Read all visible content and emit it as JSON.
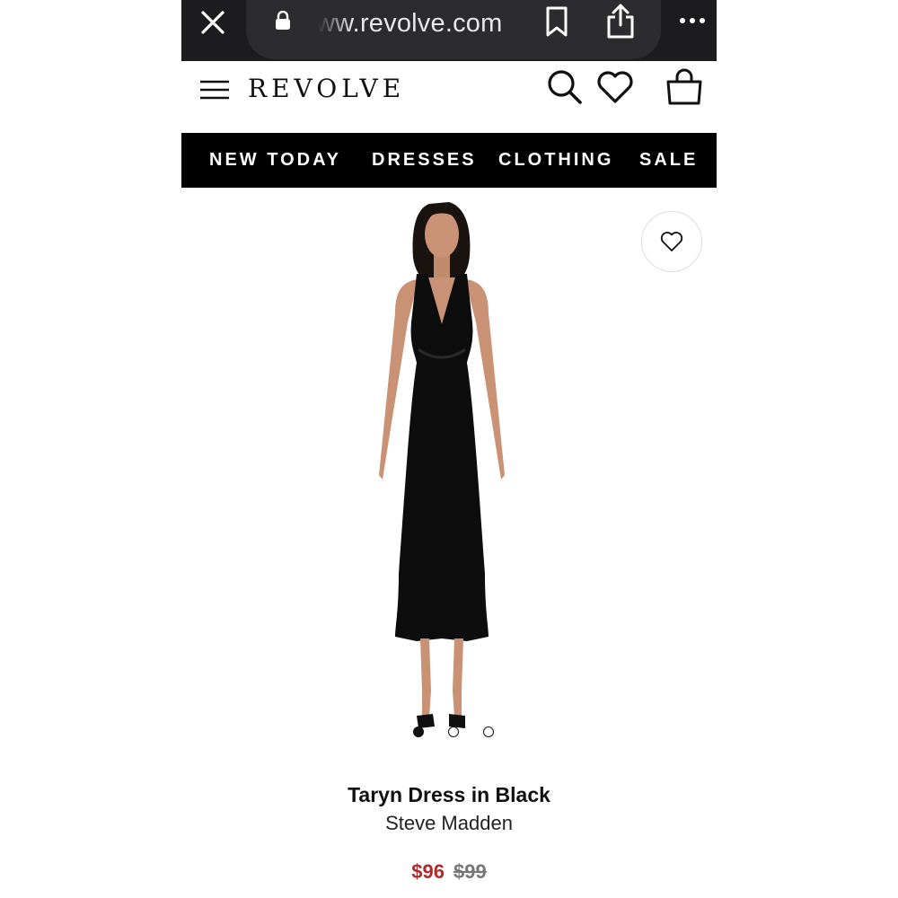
{
  "browser": {
    "url": "ww.revolve.com",
    "icons": [
      "close-icon",
      "lock-icon",
      "bookmark-icon",
      "share-icon",
      "more-icon"
    ]
  },
  "header": {
    "logo": "REVOLVE",
    "icons": [
      "menu-icon",
      "search-icon",
      "heart-icon",
      "shopping-bag-icon"
    ]
  },
  "nav": {
    "items": [
      {
        "label": "NEW TODAY"
      },
      {
        "label": "DRESSES"
      },
      {
        "label": "CLOTHING"
      },
      {
        "label": "SALE"
      }
    ]
  },
  "product": {
    "image_alt_colors": {
      "dress": "#0d0d0d",
      "skin": "#c99274",
      "hair": "#1a120e"
    },
    "carousel": {
      "count": 3,
      "active_index": 0
    },
    "title": "Taryn Dress in Black",
    "brand": "Steve Madden",
    "sale_price": "$96",
    "original_price": "$99",
    "sale_color": "#b12a2a"
  }
}
